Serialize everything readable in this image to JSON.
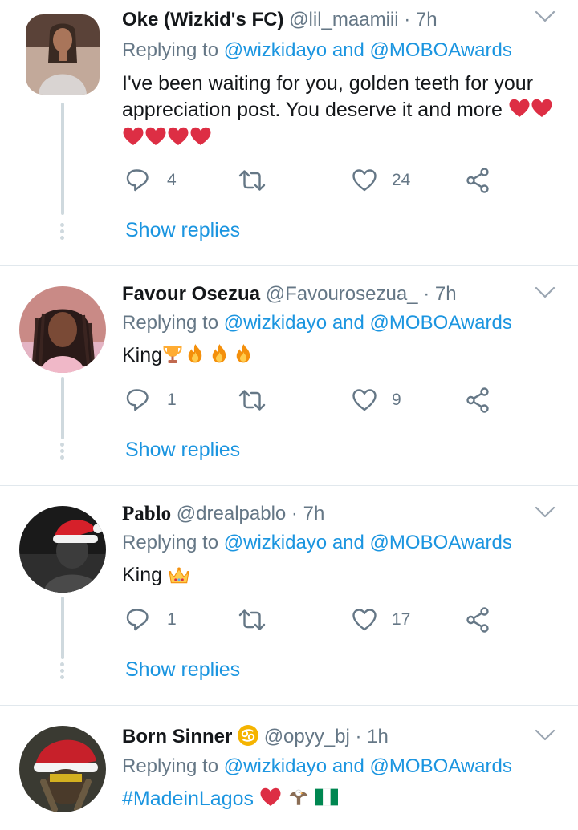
{
  "tweets": [
    {
      "name": "Oke (Wizkid's FC)",
      "handle": "@lil_maamiii",
      "sep": "·",
      "time": "7h",
      "reply_prefix": "Replying to",
      "mention_1": "@wizkidayo",
      "reply_and": "and",
      "mention_2": "@MOBOAwards",
      "text_line_1": "I've been waiting for you, golden teeth for your",
      "text_line_2": "appreciation post. You deserve it and more",
      "replies": "4",
      "retweets": "",
      "likes": "24",
      "show_replies": "Show replies"
    },
    {
      "name": "Favour Osezua",
      "handle": "@Favourosezua_",
      "sep": "·",
      "time": "7h",
      "reply_prefix": "Replying to",
      "mention_1": "@wizkidayo",
      "reply_and": "and",
      "mention_2": "@MOBOAwards",
      "text": "King",
      "replies": "1",
      "retweets": "",
      "likes": "9",
      "show_replies": "Show replies"
    },
    {
      "name": "Pablo",
      "handle": "@drealpablo",
      "sep": "·",
      "time": "7h",
      "reply_prefix": "Replying to",
      "mention_1": "@wizkidayo",
      "reply_and": "and",
      "mention_2": "@MOBOAwards",
      "text": "King",
      "replies": "1",
      "retweets": "",
      "likes": "17",
      "show_replies": "Show replies"
    },
    {
      "name": "Born Sinner",
      "handle": "@opyy_bj",
      "sep": "·",
      "time": "1h",
      "reply_prefix": "Replying to",
      "mention_1": "@wizkidayo",
      "reply_and": "and",
      "mention_2": "@MOBOAwards",
      "hashtag": "#MadeinLagos"
    }
  ],
  "colors": {
    "link": "#1b95e0",
    "muted": "#657786",
    "text": "#14171a",
    "divider": "#e1e8ed",
    "heart_emoji": "#dd2e44"
  },
  "icons": [
    "reply-icon",
    "retweet-icon",
    "like-icon",
    "share-icon",
    "chevron-down-icon",
    "heart-emoji-icon",
    "trophy-emoji-icon",
    "fire-emoji-icon",
    "crown-emoji-icon",
    "cancer-sign-icon",
    "eagle-emoji-icon",
    "nigeria-flag-icon"
  ]
}
